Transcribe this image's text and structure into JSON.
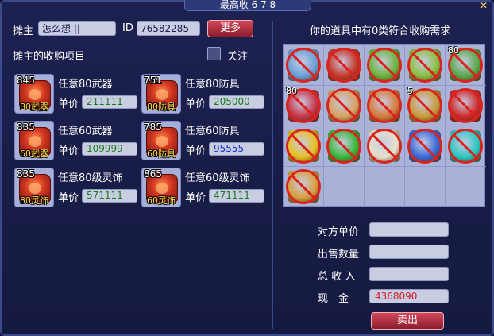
{
  "window": {
    "title": "最高收 6 7 8",
    "close_glyph": "✕"
  },
  "left": {
    "owner_label": "摊主",
    "owner_name": "怎么想 ||",
    "id_label": "ID",
    "id_value": "76582285",
    "more_button": "更多",
    "section_title": "摊主的收购项目",
    "follow_label": "关注",
    "price_label": "单价",
    "items": [
      {
        "code": "845",
        "tag": "80武器",
        "name": "任意80武器",
        "price": "211111",
        "price_color": "#1a7d1a"
      },
      {
        "code": "751",
        "tag": "80防具",
        "name": "任意80防具",
        "price": "205000",
        "price_color": "#1a7d1a"
      },
      {
        "code": "835",
        "tag": "60武器",
        "name": "任意60武器",
        "price": "109999",
        "price_color": "#1a7d1a"
      },
      {
        "code": "785",
        "tag": "60防具",
        "name": "任意60防具",
        "price": "95555",
        "price_color": "#1a2fd0"
      },
      {
        "code": "835",
        "tag": "80灵饰",
        "name": "任意80级灵饰",
        "price": "571111",
        "price_color": "#1a7d1a"
      },
      {
        "code": "865",
        "tag": "60灵饰",
        "name": "任意60级灵饰",
        "price": "471111",
        "price_color": "#1a7d1a"
      }
    ]
  },
  "right": {
    "header": "你的道具中有0类符合收购需求",
    "inventory": [
      {
        "icon": "ice-sword-icon",
        "color": "#6aa0d8",
        "banned": true,
        "count": ""
      },
      {
        "icon": "red-bag-icon",
        "color": "#c83a2a",
        "banned": true,
        "count": ""
      },
      {
        "icon": "green-chest-icon",
        "color": "#6ab43a",
        "banned": true,
        "count": ""
      },
      {
        "icon": "green-chest-icon",
        "color": "#8ac040",
        "banned": true,
        "count": ""
      },
      {
        "icon": "flower-pot-icon",
        "color": "#5aa84a",
        "banned": true,
        "count": "80"
      },
      {
        "icon": "red-fish-icon",
        "color": "#c8364a",
        "banned": true,
        "count": "80"
      },
      {
        "icon": "cake-icon",
        "color": "#d8a060",
        "banned": true,
        "count": ""
      },
      {
        "icon": "shell-icon",
        "color": "#d87a3a",
        "banned": true,
        "count": ""
      },
      {
        "icon": "scroll-icon",
        "color": "#c89a3a",
        "banned": true,
        "count": "5"
      },
      {
        "icon": "red-flag-icon",
        "color": "#d02a2a",
        "banned": true,
        "count": ""
      },
      {
        "icon": "yellow-flag-icon",
        "color": "#e8c020",
        "banned": true,
        "count": ""
      },
      {
        "icon": "green-flag-icon",
        "color": "#3ab83a",
        "banned": true,
        "count": ""
      },
      {
        "icon": "white-flag-icon",
        "color": "#e8e0c8",
        "banned": true,
        "count": ""
      },
      {
        "icon": "blue-flag-icon",
        "color": "#3a6ad8",
        "banned": true,
        "count": ""
      },
      {
        "icon": "cyan-flag-icon",
        "color": "#2ac8c0",
        "banned": true,
        "count": ""
      },
      {
        "icon": "book-icon",
        "color": "#d8a040",
        "banned": true,
        "count": ""
      },
      {
        "icon": "",
        "color": "",
        "banned": false,
        "count": ""
      },
      {
        "icon": "",
        "color": "",
        "banned": false,
        "count": ""
      },
      {
        "icon": "",
        "color": "",
        "banned": false,
        "count": ""
      },
      {
        "icon": "",
        "color": "",
        "banned": false,
        "count": ""
      }
    ],
    "unit_price_label": "对方单价",
    "sell_qty_label": "出售数量",
    "total_income_label": "总 收 入",
    "cash_label": "现　金",
    "unit_price_value": "",
    "sell_qty_value": "",
    "total_income_value": "",
    "cash_value": "4368090",
    "cash_color": "#d0202a",
    "sell_button": "卖出"
  }
}
